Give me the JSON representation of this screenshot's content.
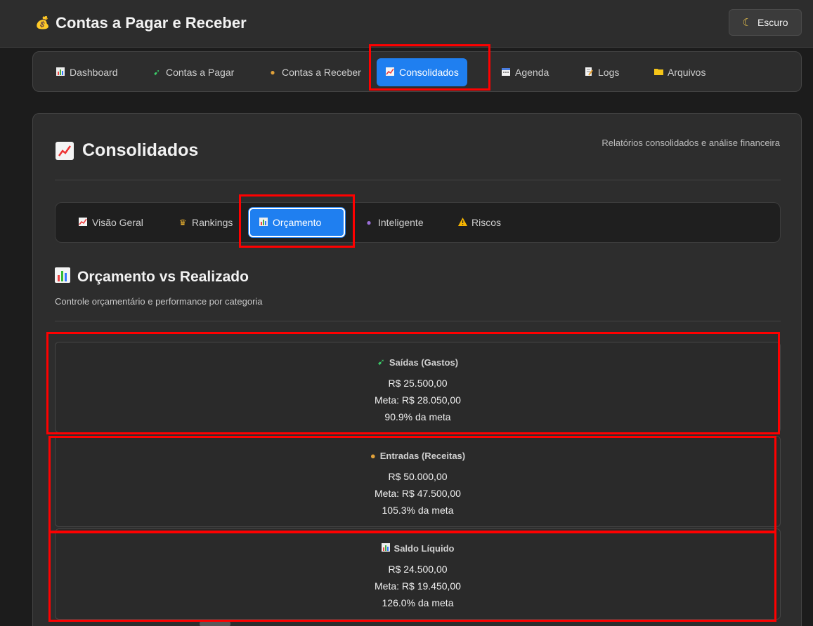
{
  "app": {
    "title": "Contas a Pagar e Receber",
    "theme_label": "Escuro"
  },
  "nav": {
    "items": [
      {
        "label": "Dashboard",
        "icon": "bar-chart-icon"
      },
      {
        "label": "Contas a Pagar",
        "icon": "flying-money-icon"
      },
      {
        "label": "Contas a Receber",
        "icon": "money-bag-icon"
      },
      {
        "label": "Consolidados",
        "icon": "trending-chart-icon",
        "active": true
      },
      {
        "label": "Agenda",
        "icon": "calendar-icon"
      },
      {
        "label": "Logs",
        "icon": "memo-icon"
      },
      {
        "label": "Arquivos",
        "icon": "folder-icon"
      }
    ]
  },
  "panel": {
    "title": "Consolidados",
    "subtitle": "Relatórios consolidados e análise financeira",
    "subtabs": [
      {
        "label": "Visão Geral",
        "icon": "trending-chart-icon"
      },
      {
        "label": "Rankings",
        "icon": "trophy-icon"
      },
      {
        "label": "Orçamento",
        "icon": "bar-chart-icon",
        "active": true
      },
      {
        "label": "Inteligente",
        "icon": "crystal-ball-icon"
      },
      {
        "label": "Riscos",
        "icon": "warning-icon"
      }
    ],
    "section_title": "Orçamento vs Realizado",
    "section_subtitle": "Controle orçamentário e performance por categoria"
  },
  "cards": [
    {
      "label": "Saídas (Gastos)",
      "icon": "flying-money-icon",
      "value": "R$ 25.500,00",
      "target": "Meta: R$ 28.050,00",
      "percent": "90.9% da meta"
    },
    {
      "label": "Entradas (Receitas)",
      "icon": "money-bag-icon",
      "value": "R$ 50.000,00",
      "target": "Meta: R$ 47.500,00",
      "percent": "105.3% da meta"
    },
    {
      "label": "Saldo Líquido",
      "icon": "bar-chart-icon",
      "value": "R$ 24.500,00",
      "target": "Meta: R$ 19.450,00",
      "percent": "126.0% da meta"
    }
  ],
  "colors": {
    "accent": "#1f7ff0",
    "highlight": "#ff0000",
    "background": "#1c1c1c",
    "surface": "#2d2d2d"
  }
}
